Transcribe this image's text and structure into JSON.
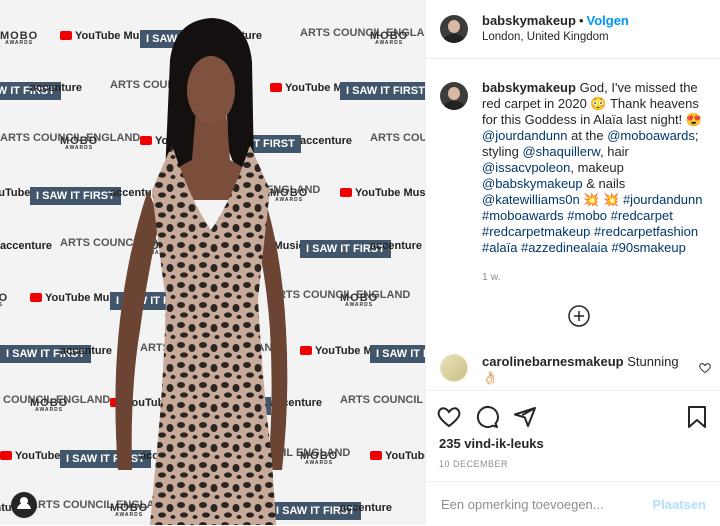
{
  "photo": {
    "backdrop": {
      "mobo": "MOBO",
      "mobo_sub": "AWARDS",
      "youtube": "YouTube Music",
      "saw_it_first": "I SAW IT FIRST",
      "accenture": "accenture",
      "arts_council": "ARTS COUNCIL ENGLAND"
    },
    "dress_colors": [
      "#2b2522",
      "#c7aa99"
    ]
  },
  "header": {
    "username": "babskymakeup",
    "separator": "•",
    "follow_label": "Volgen",
    "location": "London, United Kingdom"
  },
  "caption": {
    "username": "babskymakeup",
    "parts": [
      {
        "text": "God, I've missed the red carpet in 2020 😳 Thank heavens for this Goddess in Alaïa last night! 😍 "
      },
      {
        "tag": "@jourdandunn"
      },
      {
        "text": " at the "
      },
      {
        "tag": "@moboawards"
      },
      {
        "text": "; styling "
      },
      {
        "tag": "@shaquillerw"
      },
      {
        "text": ", hair "
      },
      {
        "tag": "@issacvpoleon"
      },
      {
        "text": ", makeup "
      },
      {
        "tag": "@babskymakeup"
      },
      {
        "text": " & nails "
      },
      {
        "tag": "@katewilliams0n"
      },
      {
        "text": " 💥 💥 "
      },
      {
        "tag": "#jourdandunn"
      },
      {
        "text": " "
      },
      {
        "tag": "#moboawards"
      },
      {
        "text": " "
      },
      {
        "tag": "#mobo"
      },
      {
        "text": " "
      },
      {
        "tag": "#redcarpet"
      },
      {
        "text": " "
      },
      {
        "tag": "#redcarpetmakeup"
      },
      {
        "text": " "
      },
      {
        "tag": "#redcarpetfashion"
      },
      {
        "text": " "
      },
      {
        "tag": "#alaïa"
      },
      {
        "text": " "
      },
      {
        "tag": "#azzedinealaia"
      },
      {
        "text": " "
      },
      {
        "tag": "#90smakeup"
      }
    ],
    "time_ago": "1 w."
  },
  "load_more_icon": "plus-circle-icon",
  "comment": {
    "username": "carolinebarnesmakeup",
    "text": "Stunning 👌🏻"
  },
  "actions": {
    "icons": [
      "heart-icon",
      "comment-icon",
      "share-icon",
      "bookmark-icon"
    ],
    "likes": "235 vind-ik-leuks",
    "date": "10 DECEMBER"
  },
  "add_comment": {
    "placeholder": "Een opmerking toevoegen...",
    "post_label": "Plaatsen"
  },
  "colors": {
    "link": "#0095f6",
    "tag": "#00376b",
    "muted": "#8e8e8e",
    "post_disabled": "#b2dffc"
  }
}
